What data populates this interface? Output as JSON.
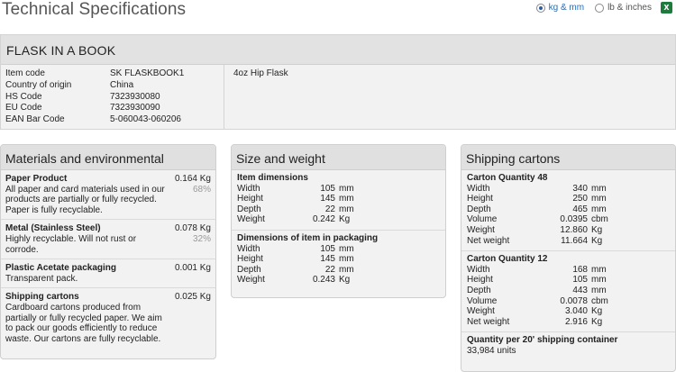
{
  "page": {
    "title": "Technical Specifications"
  },
  "units": {
    "metric_label": "kg & mm",
    "imperial_label": "lb & inches",
    "selected": "metric",
    "excel_icon": "X"
  },
  "product": {
    "name": "FLASK IN A BOOK",
    "fields": [
      {
        "label": "Item code",
        "value": "SK FLASKBOOK1"
      },
      {
        "label": "Country of origin",
        "value": "China"
      },
      {
        "label": "HS Code",
        "value": "7323930080"
      },
      {
        "label": "EU Code",
        "value": "7323930090"
      },
      {
        "label": "EAN Bar Code",
        "value": "5-060043-060206"
      }
    ],
    "description": "4oz Hip Flask"
  },
  "materials": {
    "title": "Materials and environmental",
    "items": [
      {
        "name": "Paper Product",
        "weight": "0.164 Kg",
        "desc": "All paper and card materials used in our products are partially or fully recycled. Paper is fully recyclable.",
        "percent": "68%"
      },
      {
        "name": "Metal (Stainless Steel)",
        "weight": "0.078 Kg",
        "desc": "Highly recyclable. Will not rust or corrode.",
        "percent": "32%"
      },
      {
        "name": "Plastic Acetate packaging",
        "weight": "0.001 Kg",
        "desc": "Transparent pack.",
        "percent": ""
      },
      {
        "name": "Shipping cartons",
        "weight": "0.025 Kg",
        "desc": "Cardboard cartons produced from partially or fully recycled paper. We aim to pack our goods efficiently to reduce waste. Our cartons are fully recyclable.",
        "percent": ""
      }
    ]
  },
  "size": {
    "title": "Size and weight",
    "item_dims": {
      "title": "Item dimensions",
      "rows": [
        {
          "label": "Width",
          "value": "105",
          "unit": "mm"
        },
        {
          "label": "Height",
          "value": "145",
          "unit": "mm"
        },
        {
          "label": "Depth",
          "value": "22",
          "unit": "mm"
        },
        {
          "label": "Weight",
          "value": "0.242",
          "unit": "Kg"
        }
      ]
    },
    "pack_dims": {
      "title": "Dimensions of item in packaging",
      "rows": [
        {
          "label": "Width",
          "value": "105",
          "unit": "mm"
        },
        {
          "label": "Height",
          "value": "145",
          "unit": "mm"
        },
        {
          "label": "Depth",
          "value": "22",
          "unit": "mm"
        },
        {
          "label": "Weight",
          "value": "0.243",
          "unit": "Kg"
        }
      ]
    }
  },
  "shipping": {
    "title": "Shipping cartons",
    "carton48": {
      "title": "Carton Quantity 48",
      "rows": [
        {
          "label": "Width",
          "value": "340",
          "unit": "mm"
        },
        {
          "label": "Height",
          "value": "250",
          "unit": "mm"
        },
        {
          "label": "Depth",
          "value": "465",
          "unit": "mm"
        },
        {
          "label": "Volume",
          "value": "0.0395",
          "unit": "cbm"
        },
        {
          "label": "Weight",
          "value": "12.860",
          "unit": "Kg"
        },
        {
          "label": "Net weight",
          "value": "11.664",
          "unit": "Kg"
        }
      ]
    },
    "carton12": {
      "title": "Carton Quantity 12",
      "rows": [
        {
          "label": "Width",
          "value": "168",
          "unit": "mm"
        },
        {
          "label": "Height",
          "value": "105",
          "unit": "mm"
        },
        {
          "label": "Depth",
          "value": "443",
          "unit": "mm"
        },
        {
          "label": "Volume",
          "value": "0.0078",
          "unit": "cbm"
        },
        {
          "label": "Weight",
          "value": "3.040",
          "unit": "Kg"
        },
        {
          "label": "Net weight",
          "value": "2.916",
          "unit": "Kg"
        }
      ]
    },
    "container": {
      "title": "Quantity per 20' shipping container",
      "value": "33,984 units"
    }
  }
}
